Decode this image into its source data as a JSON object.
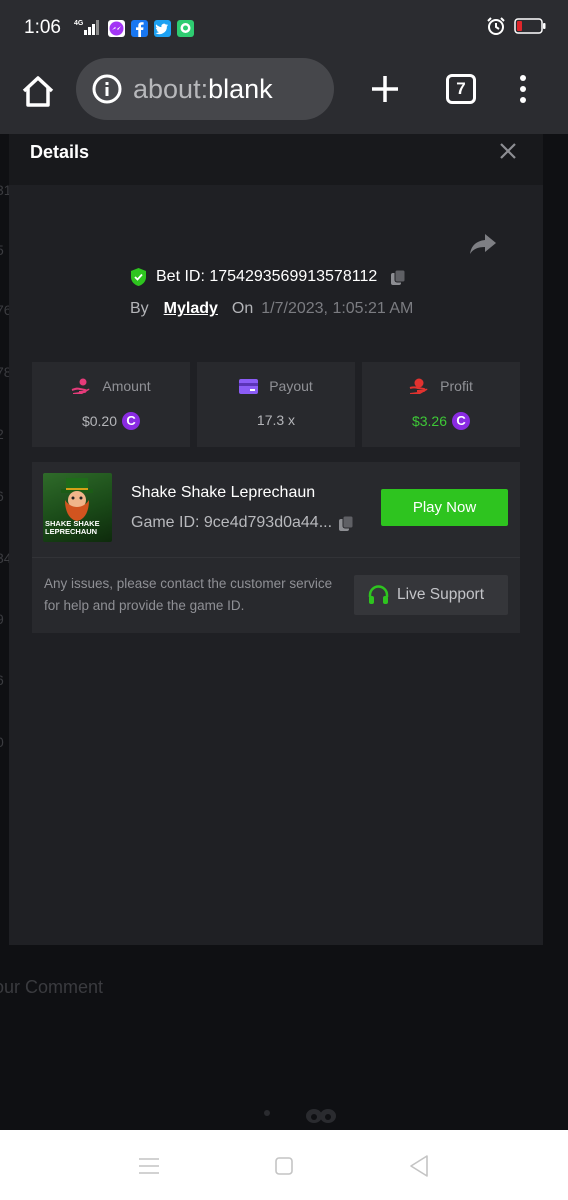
{
  "status_bar": {
    "time": "1:06",
    "network": "4G",
    "apps": [
      "messenger-icon",
      "facebook-icon",
      "twitter-icon",
      "chat-app-icon"
    ],
    "right_icons": [
      "alarm-icon",
      "battery-low-icon"
    ],
    "colors": {
      "battery_low": "#e0262b"
    }
  },
  "browser": {
    "url_scheme": "about:",
    "url_rest": "blank",
    "tab_count": "7"
  },
  "background_page": {
    "comment_placeholder": "our Comment",
    "edge_digits": [
      "31",
      "5",
      "76",
      "78",
      "2",
      "6",
      "34",
      "9",
      "6",
      "0"
    ]
  },
  "modal": {
    "title": "Details",
    "bet_id_label": "Bet ID: 1754293569913578112",
    "by_label": "By",
    "username": "Mylady",
    "on_label": "On",
    "date": "1/7/2023, 1:05:21 AM",
    "stats": [
      {
        "label": "Amount",
        "value": "$0.20",
        "coin": "C",
        "icon": "hand-coin-icon"
      },
      {
        "label": "Payout",
        "value": "17.3 x",
        "icon": "card-icon"
      },
      {
        "label": "Profit",
        "value": "$3.26",
        "coin": "C",
        "icon": "profit-hand-icon"
      }
    ],
    "game": {
      "name": "Shake Shake Leprechaun",
      "game_id": "Game ID: 9ce4d793d0a44...",
      "thumb_title_line1": "SHAKE SHAKE",
      "thumb_title_line2": "LEPRECHAUN",
      "play_label": "Play Now"
    },
    "support_text": "Any issues, please contact the customer service for help and provide the game ID.",
    "support_label": "Live Support",
    "colors": {
      "accent_green": "#2ec41f",
      "profit_green": "#3ec837",
      "coin_purple": "#8a2be2",
      "shield_green": "#2ec41f"
    }
  }
}
